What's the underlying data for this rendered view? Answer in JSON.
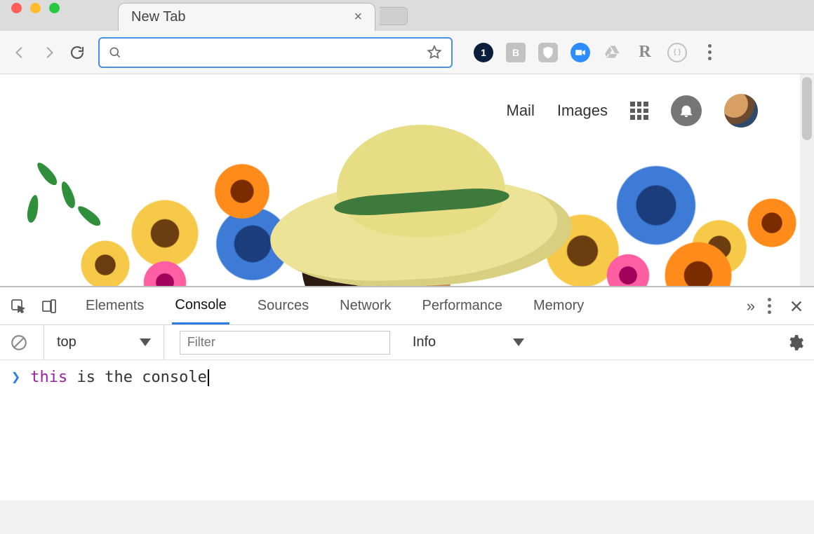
{
  "window": {
    "tab_title": "New Tab"
  },
  "toolbar": {
    "omnibox_value": "",
    "omnibox_placeholder": "",
    "ext_badge": "1",
    "ext_square": "B",
    "ext_letter": "R"
  },
  "page": {
    "gbar": {
      "mail": "Mail",
      "images": "Images"
    }
  },
  "devtools": {
    "tabs": {
      "elements": "Elements",
      "console": "Console",
      "sources": "Sources",
      "network": "Network",
      "performance": "Performance",
      "memory": "Memory"
    },
    "context": "top",
    "filter_placeholder": "Filter",
    "level": "Info",
    "console_input": {
      "kw": "this",
      "rest": " is the console"
    }
  }
}
